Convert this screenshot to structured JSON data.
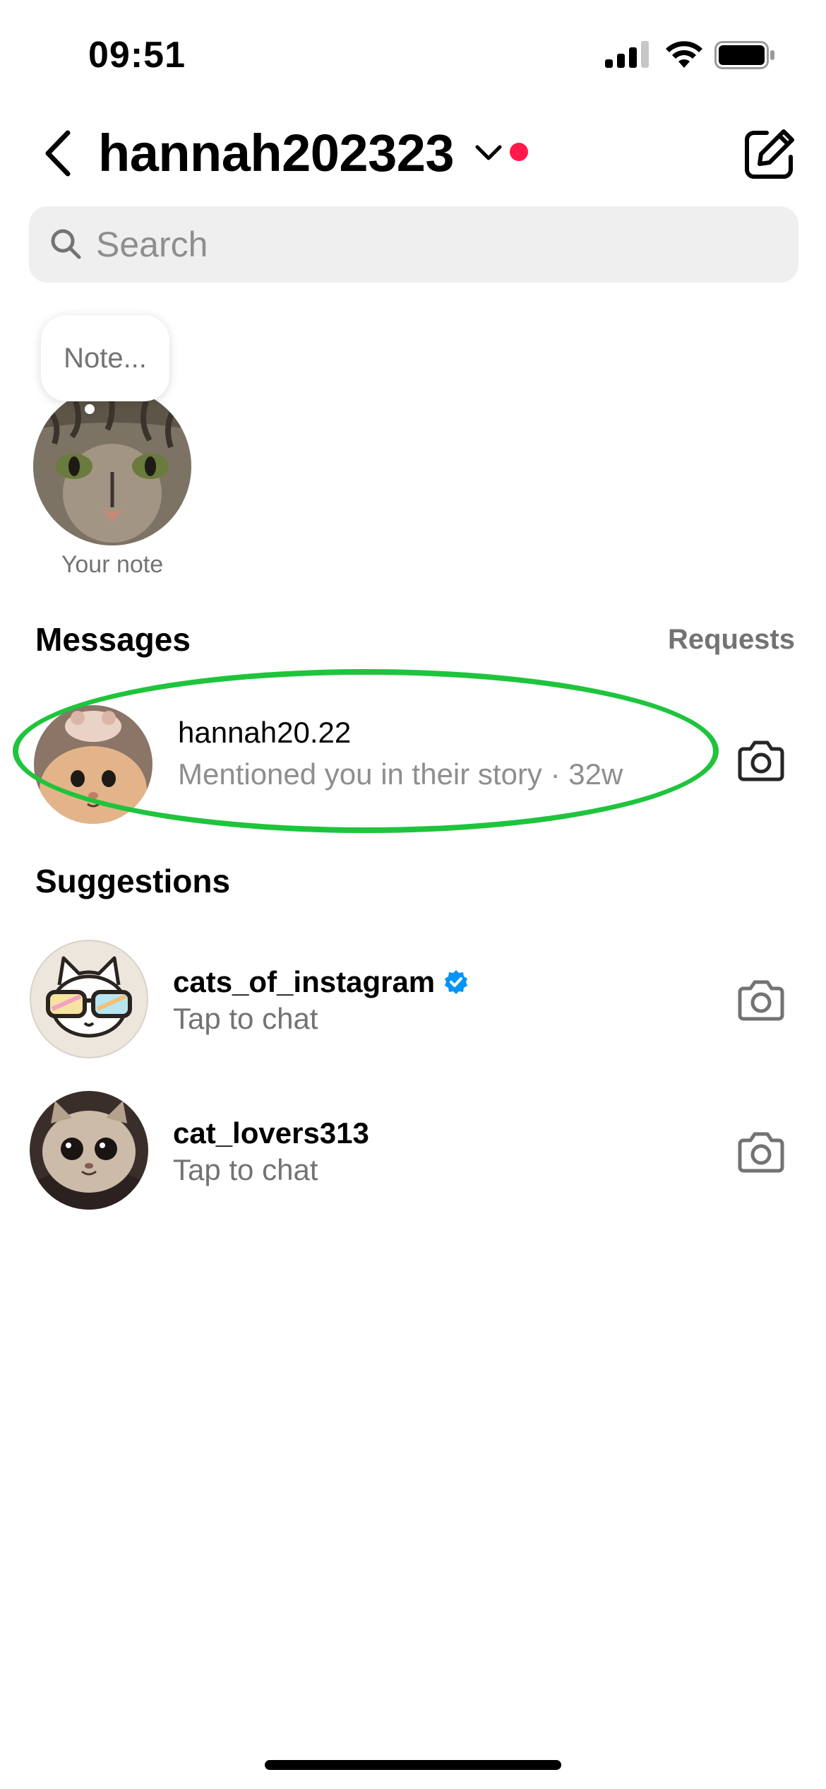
{
  "status_bar": {
    "time": "09:51"
  },
  "header": {
    "account_name": "hannah202323",
    "unread_dot_color": "#ff1a4b",
    "icons": [
      "back-chevron-icon",
      "chevron-down-icon",
      "compose-icon"
    ]
  },
  "search": {
    "placeholder": "Search",
    "value": ""
  },
  "note": {
    "bubble_text": "Note...",
    "caption": "Your note"
  },
  "messages": {
    "heading": "Messages",
    "requests_label": "Requests",
    "threads": [
      {
        "username": "hannah20.22",
        "preview": "Mentioned you in their story · 32w",
        "highlighted": true,
        "highlight_color": "#1fc43c"
      }
    ]
  },
  "suggestions": {
    "heading": "Suggestions",
    "items": [
      {
        "username": "cats_of_instagram",
        "verified": true,
        "subtitle": "Tap to chat"
      },
      {
        "username": "cat_lovers313",
        "verified": false,
        "subtitle": "Tap to chat"
      }
    ]
  },
  "colors": {
    "verified_blue": "#0095f6",
    "secondary_text": "#8e8e8e",
    "search_bg": "#efefef"
  }
}
